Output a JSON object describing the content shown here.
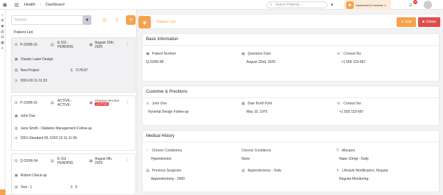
{
  "topbar": {
    "breadcrumb_1": "Health",
    "breadcrumb_2": "Dashboard",
    "search_placeholder": "Search Patients...",
    "brand_name": "Dashboard & Invoiced",
    "notif_count": "12"
  },
  "list": {
    "search_placeholder": "Search",
    "title": "Patient List",
    "cards": [
      {
        "id": "P-23/08-15",
        "status_line1": "E-311 -",
        "status_line2": "PENDING",
        "date_line1": "August 15th,",
        "date_line2": "2025",
        "name": "Classic Laser Design",
        "project": "New Project",
        "amount": "7178.87",
        "ref": "2001-00 11-11.53"
      },
      {
        "id": "P-23/08-15",
        "status_line1": "ACTIVE -",
        "status_line2": "ACTIVE",
        "date_line1": "PENDING REVIEW",
        "date_line2": "ACTIVE",
        "name": "John Doe",
        "project": "Jane Smith - Diabetes Management Follow-up",
        "ref": "2001-Standard 55, 6202-10 11-11.99"
      },
      {
        "id": "Q-23/06-54",
        "status_line1": "E-311 -",
        "status_line2": "PENDING",
        "date_line1": "August 8th,",
        "date_line2": "2025",
        "name": "Robert Check-up",
        "project": "Test - 1",
        "amount": "0"
      }
    ]
  },
  "header": {
    "title": "Patient List",
    "edit_label": "Edit",
    "delete_label": "Delete"
  },
  "basic": {
    "title": "Basic Information",
    "patient_number_label": "Patient Number",
    "patient_number": "Q-23/06-58",
    "quotation_date_label": "Quotation Date",
    "quotation_date": "August 22nd, 2025",
    "contact_label": "Contact No:",
    "contact": "+1 555 123-667"
  },
  "customer": {
    "title": "Customer & Precitions",
    "name": "John Doe",
    "note": "Hyvertal Design Follow-up",
    "dob_label": "Date Borth Pjrth",
    "dob": "May 10, 1970",
    "contact_label": "Contact No:",
    "contact": "+1 555 123-667"
  },
  "history": {
    "title": "Medical History",
    "chronic1_label": "Chronic Condistons",
    "chronic1": "Hypertension",
    "chronic2_label": "Chronic Conditions",
    "chronic2": "None",
    "allergies_label": "Allergies",
    "allergies": "Nape 10mgl - Daily",
    "surgeries_label": "Previous Surgeries",
    "surgeries": "Appendoctomy - 2000",
    "appendectomy_label": "Appendectomy - Daily",
    "lifestyle_label": "Lifestyle Modification, Regular",
    "lifestyle": "Regular Monitoring"
  }
}
